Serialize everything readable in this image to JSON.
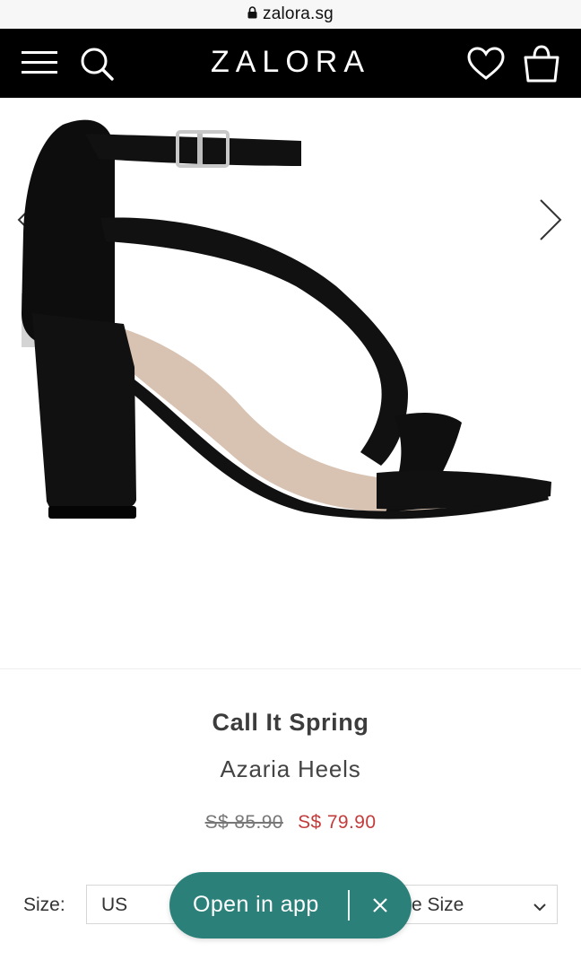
{
  "browser": {
    "url": "zalora.sg"
  },
  "header": {
    "logo": "ZALORA",
    "icons": [
      "menu-icon",
      "search-icon",
      "heart-icon",
      "shopping-bag-icon"
    ]
  },
  "product": {
    "brand": "Call It Spring",
    "name": "Azaria Heels",
    "original_price": "S$ 85.90",
    "sale_price": "S$ 79.90"
  },
  "size": {
    "label": "Size:",
    "system_value": "US",
    "size_value": "e Size"
  },
  "app_banner": {
    "label": "Open in app"
  },
  "colors": {
    "header_bg": "#000000",
    "sale_price": "#c43b3b",
    "app_pill": "#2c807a"
  }
}
